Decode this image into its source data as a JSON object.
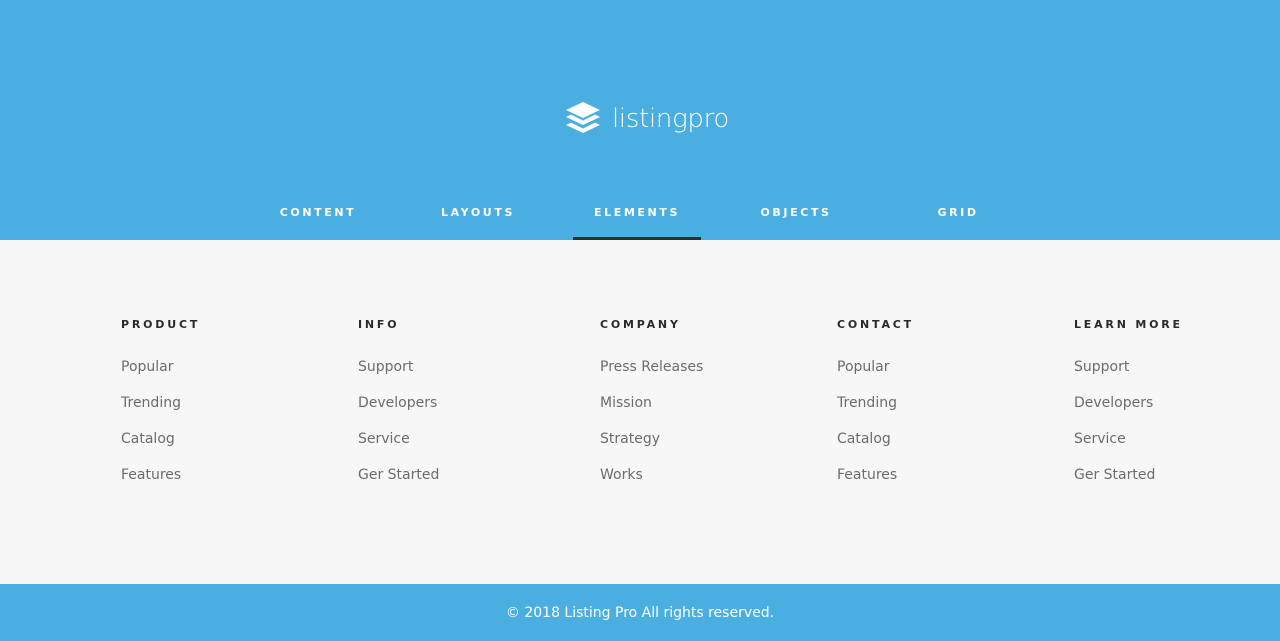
{
  "brand": {
    "name": "listingpro",
    "icon": "layers-icon",
    "color": "#4aaee0"
  },
  "nav": {
    "items": [
      {
        "label": "CONTENT"
      },
      {
        "label": "LAYOUTS"
      },
      {
        "label": "ELEMENTS"
      },
      {
        "label": "OBJECTS"
      },
      {
        "label": "GRID"
      }
    ],
    "active": "ELEMENTS"
  },
  "columns": [
    {
      "title": "PRODUCT",
      "links": [
        "Popular",
        "Trending",
        "Catalog",
        "Features"
      ]
    },
    {
      "title": "INFO",
      "links": [
        "Support",
        "Developers",
        "Service",
        "Ger Started"
      ]
    },
    {
      "title": "COMPANY",
      "links": [
        "Press Releases",
        "Mission",
        "Strategy",
        "Works"
      ]
    },
    {
      "title": "CONTACT",
      "links": [
        "Popular",
        "Trending",
        "Catalog",
        "Features"
      ]
    },
    {
      "title": "LEARN MORE",
      "links": [
        "Support",
        "Developers",
        "Service",
        "Ger Started"
      ]
    }
  ],
  "footer": {
    "copyright": "© 2018 Listing Pro All rights reserved."
  }
}
